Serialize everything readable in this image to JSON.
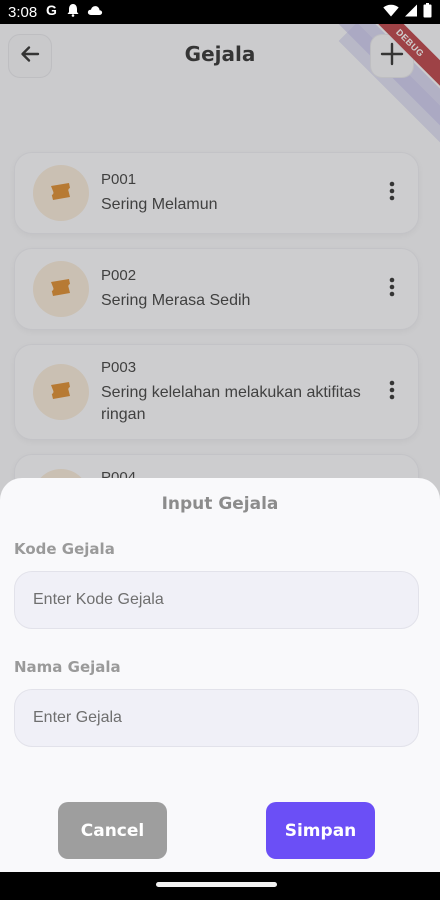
{
  "status_bar": {
    "time": "3:08",
    "left_icons": [
      "google-g-icon",
      "bell-icon",
      "cloud-icon"
    ],
    "right_icons": [
      "wifi-icon",
      "signal-icon",
      "battery-icon"
    ]
  },
  "appbar": {
    "title": "Gejala",
    "back_icon": "arrow-left-icon",
    "add_icon": "plus-icon",
    "debug_label": "DEBUG"
  },
  "list": {
    "items": [
      {
        "code": "P001",
        "name": "Sering Melamun"
      },
      {
        "code": "P002",
        "name": "Sering Merasa Sedih"
      },
      {
        "code": "P003",
        "name": "Sering kelelahan melakukan aktifitas ringan"
      },
      {
        "code": "P004",
        "name": ""
      }
    ]
  },
  "sheet": {
    "title": "Input Gejala",
    "code_label": "Kode Gejala",
    "code_placeholder": "Enter Kode Gejala",
    "code_value": "",
    "name_label": "Nama Gejala",
    "name_placeholder": "Enter Gejala",
    "name_value": "",
    "cancel_label": "Cancel",
    "save_label": "Simpan"
  },
  "colors": {
    "accent": "#6b4ff6",
    "cancel": "#9e9e9e",
    "avatar_bg": "#f6e6d3",
    "icon_orange": "#d97b0f"
  }
}
